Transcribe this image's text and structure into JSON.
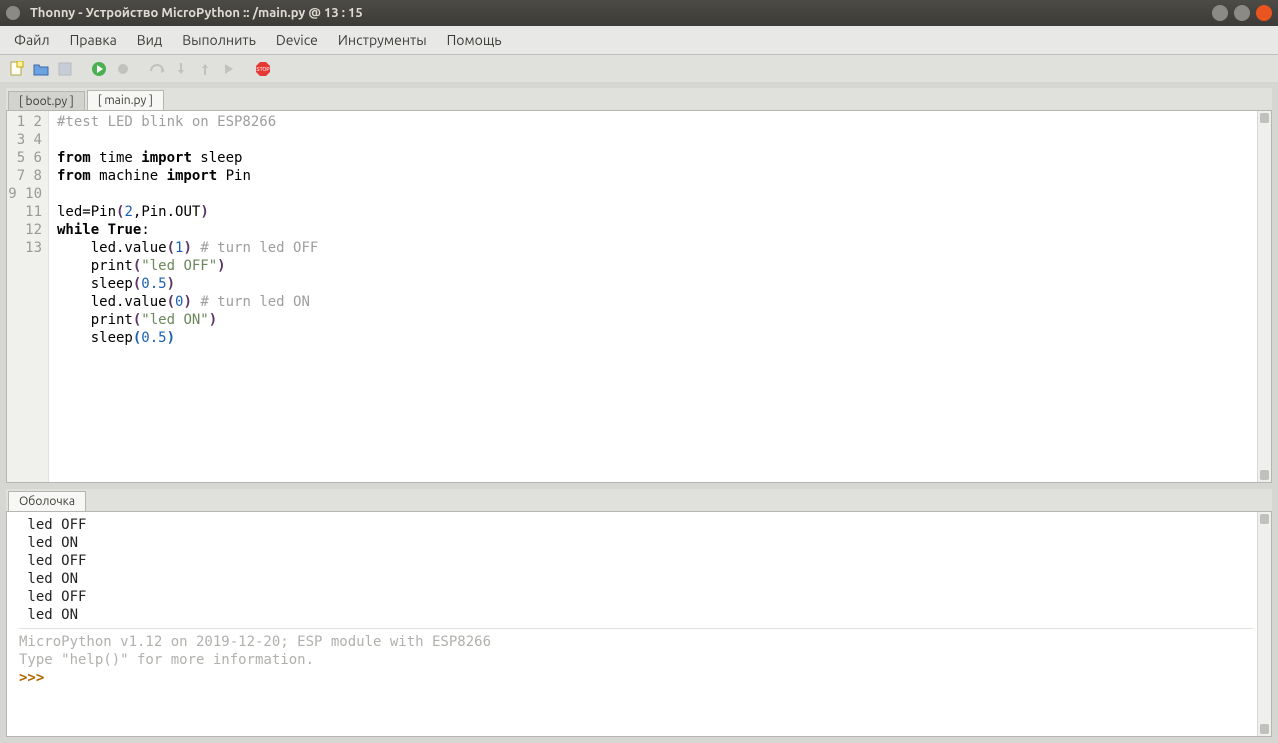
{
  "window": {
    "title": "Thonny  -  Устройство MicroPython :: /main.py  @  13 : 15"
  },
  "menu": {
    "file": "Файл",
    "edit": "Правка",
    "view": "Вид",
    "run": "Выполнить",
    "device": "Device",
    "tools": "Инструменты",
    "help": "Помощь"
  },
  "tabs": {
    "boot": "[ boot.py ]",
    "main": "[ main.py ]"
  },
  "code": {
    "lines": [
      "1",
      "2",
      "3",
      "4",
      "5",
      "6",
      "7",
      "8",
      "9",
      "10",
      "11",
      "12",
      "13"
    ],
    "l1_comment": "#test LED blink on ESP8266",
    "l3_from": "from",
    "l3_mod": " time ",
    "l3_import": "import",
    "l3_name": " sleep",
    "l4_from": "from",
    "l4_mod": " machine ",
    "l4_import": "import",
    "l4_name": " Pin",
    "l6_text": "led=Pin",
    "l6_args": "2",
    "l6_rest": ",Pin.OUT",
    "l7_while": "while",
    "l7_true": " True",
    "l7_colon": ":",
    "l8_pre": "    led.value",
    "l8_arg": "1",
    "l8_comment": " # turn led OFF",
    "l9_pre": "    print",
    "l9_str": "\"led OFF\"",
    "l10_pre": "    sleep",
    "l10_arg": "0.5",
    "l11_pre": "    led.value",
    "l11_arg": "0",
    "l11_comment": " # turn led ON",
    "l12_pre": "    print",
    "l12_str": "\"led ON\"",
    "l13_pre": "    sleep",
    "l13_arg": "0.5"
  },
  "shell": {
    "tab": "Оболочка",
    "out": " led OFF\n led ON\n led OFF\n led ON\n led OFF\n led ON",
    "banner1": "MicroPython v1.12 on 2019-12-20; ESP module with ESP8266",
    "banner2": "Type \"help()\" for more information.",
    "prompt": ">>>"
  }
}
